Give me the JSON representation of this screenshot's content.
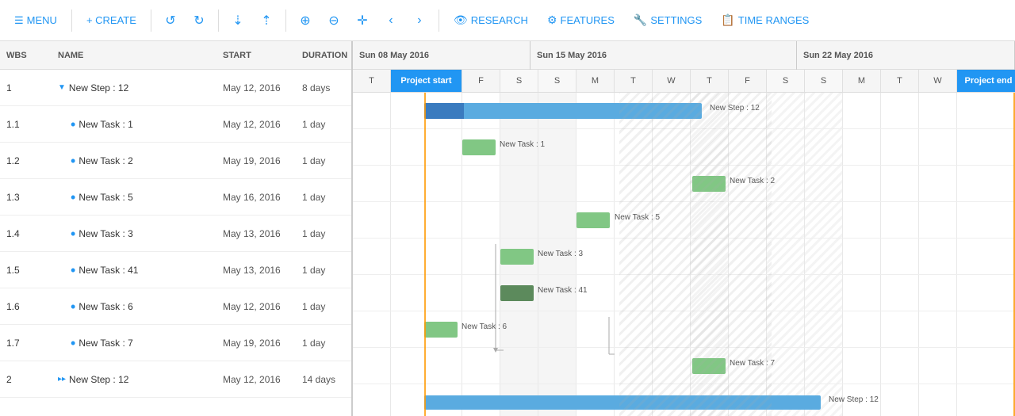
{
  "toolbar": {
    "menu_label": "MENU",
    "create_label": "+ CREATE",
    "research_label": "RESEARCH",
    "features_label": "FEATURES",
    "settings_label": "SETTINGS",
    "time_ranges_label": "TIME RANGES"
  },
  "grid": {
    "columns": [
      "WBS",
      "Name",
      "Start",
      "Duration"
    ],
    "rows": [
      {
        "wbs": "1",
        "name": "New Step : 12",
        "indent": 0,
        "type": "step",
        "start": "May 12, 2016",
        "duration": "8 days"
      },
      {
        "wbs": "1.1",
        "name": "New Task : 1",
        "indent": 1,
        "type": "task",
        "start": "May 12, 2016",
        "duration": "1 day"
      },
      {
        "wbs": "1.2",
        "name": "New Task : 2",
        "indent": 1,
        "type": "task",
        "start": "May 19, 2016",
        "duration": "1 day"
      },
      {
        "wbs": "1.3",
        "name": "New Task : 5",
        "indent": 1,
        "type": "task",
        "start": "May 16, 2016",
        "duration": "1 day"
      },
      {
        "wbs": "1.4",
        "name": "New Task : 3",
        "indent": 1,
        "type": "task",
        "start": "May 13, 2016",
        "duration": "1 day"
      },
      {
        "wbs": "1.5",
        "name": "New Task : 41",
        "indent": 1,
        "type": "task",
        "start": "May 13, 2016",
        "duration": "1 day"
      },
      {
        "wbs": "1.6",
        "name": "New Task : 6",
        "indent": 1,
        "type": "task",
        "start": "May 12, 2016",
        "duration": "1 day"
      },
      {
        "wbs": "1.7",
        "name": "New Task : 7",
        "indent": 1,
        "type": "task",
        "start": "May 19, 2016",
        "duration": "1 day"
      },
      {
        "wbs": "2",
        "name": "New Step : 12",
        "indent": 0,
        "type": "step",
        "start": "May 12, 2016",
        "duration": "14 days"
      }
    ]
  },
  "gantt": {
    "week1_label": "Sun 08 May 2016",
    "week2_label": "Sun 15 May 2016",
    "week3_label": "Sun 22 May 2016",
    "days": [
      {
        "label": "T",
        "weekend": false
      },
      {
        "label": "Project start",
        "weekend": false,
        "special": "project-start"
      },
      {
        "label": "F",
        "weekend": false
      },
      {
        "label": "S",
        "weekend": true
      },
      {
        "label": "S",
        "weekend": true
      },
      {
        "label": "M",
        "weekend": false
      },
      {
        "label": "T",
        "weekend": false
      },
      {
        "label": "W",
        "weekend": false
      },
      {
        "label": "T",
        "weekend": false
      },
      {
        "label": "F",
        "weekend": false
      },
      {
        "label": "S",
        "weekend": true
      },
      {
        "label": "S",
        "weekend": true
      },
      {
        "label": "M",
        "weekend": false
      },
      {
        "label": "T",
        "weekend": false
      },
      {
        "label": "W",
        "weekend": false
      },
      {
        "label": "Project end",
        "weekend": false,
        "special": "project-end"
      }
    ]
  }
}
